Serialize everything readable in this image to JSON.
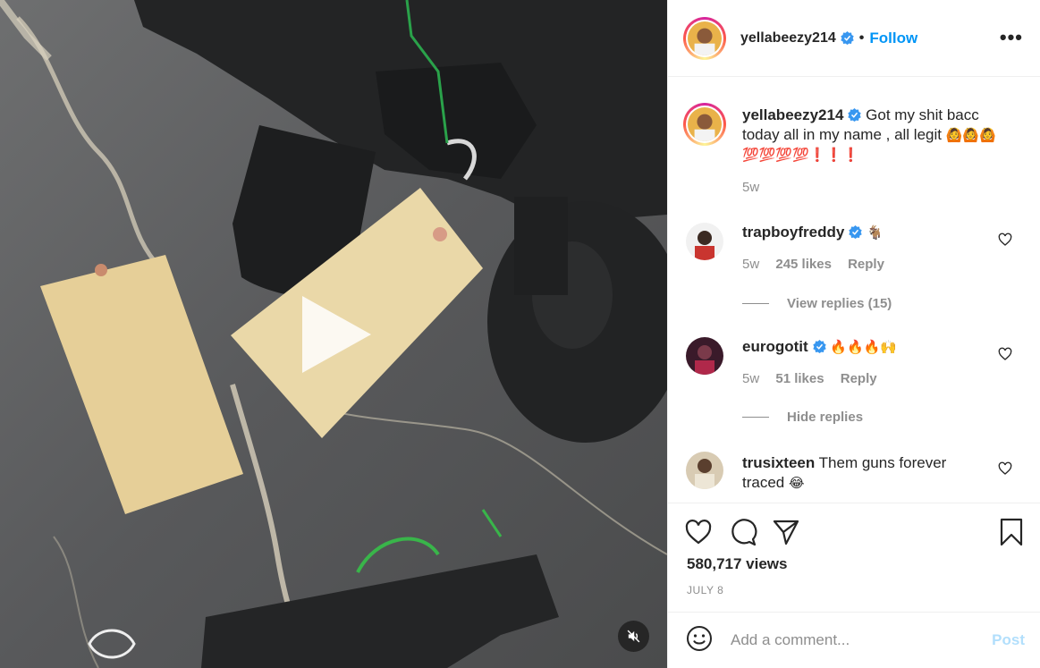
{
  "header": {
    "username": "yellabeezy214",
    "separator": "•",
    "follow_label": "Follow",
    "more_label": "•••"
  },
  "caption": {
    "username": "yellabeezy214",
    "text": "Got my shit bacc today all in my name , all legit",
    "emojis": "🙆🙆🙆💯💯💯💯❗❗❗",
    "time": "5w"
  },
  "comments": [
    {
      "username": "trapboyfreddy",
      "verified": true,
      "text": "",
      "emojis": "🐐",
      "time": "5w",
      "likes": "245 likes",
      "reply_label": "Reply",
      "replies_toggle": "View replies (15)"
    },
    {
      "username": "eurogotit",
      "verified": true,
      "text": "",
      "emojis": "🔥🔥🔥🙌",
      "time": "5w",
      "likes": "51 likes",
      "reply_label": "Reply",
      "replies_toggle": "Hide replies"
    },
    {
      "username": "trusixteen",
      "verified": false,
      "text": "Them guns forever traced",
      "emojis": "😂"
    }
  ],
  "stats": {
    "views": "580,717 views",
    "date": "JULY 8"
  },
  "add_comment": {
    "placeholder": "Add a comment...",
    "post_label": "Post"
  },
  "icons": {
    "verified": "verified-badge-icon",
    "like": "heart-icon",
    "comment": "comment-bubble-icon",
    "share": "paper-plane-icon",
    "save": "bookmark-icon",
    "emoji": "smiley-icon",
    "mute": "speaker-muted-icon",
    "play": "play-icon"
  },
  "colors": {
    "link_blue": "#0095f6",
    "muted_gray": "#8e8e8e",
    "verified_blue": "#3897f0",
    "post_disabled": "#b2dffc"
  }
}
